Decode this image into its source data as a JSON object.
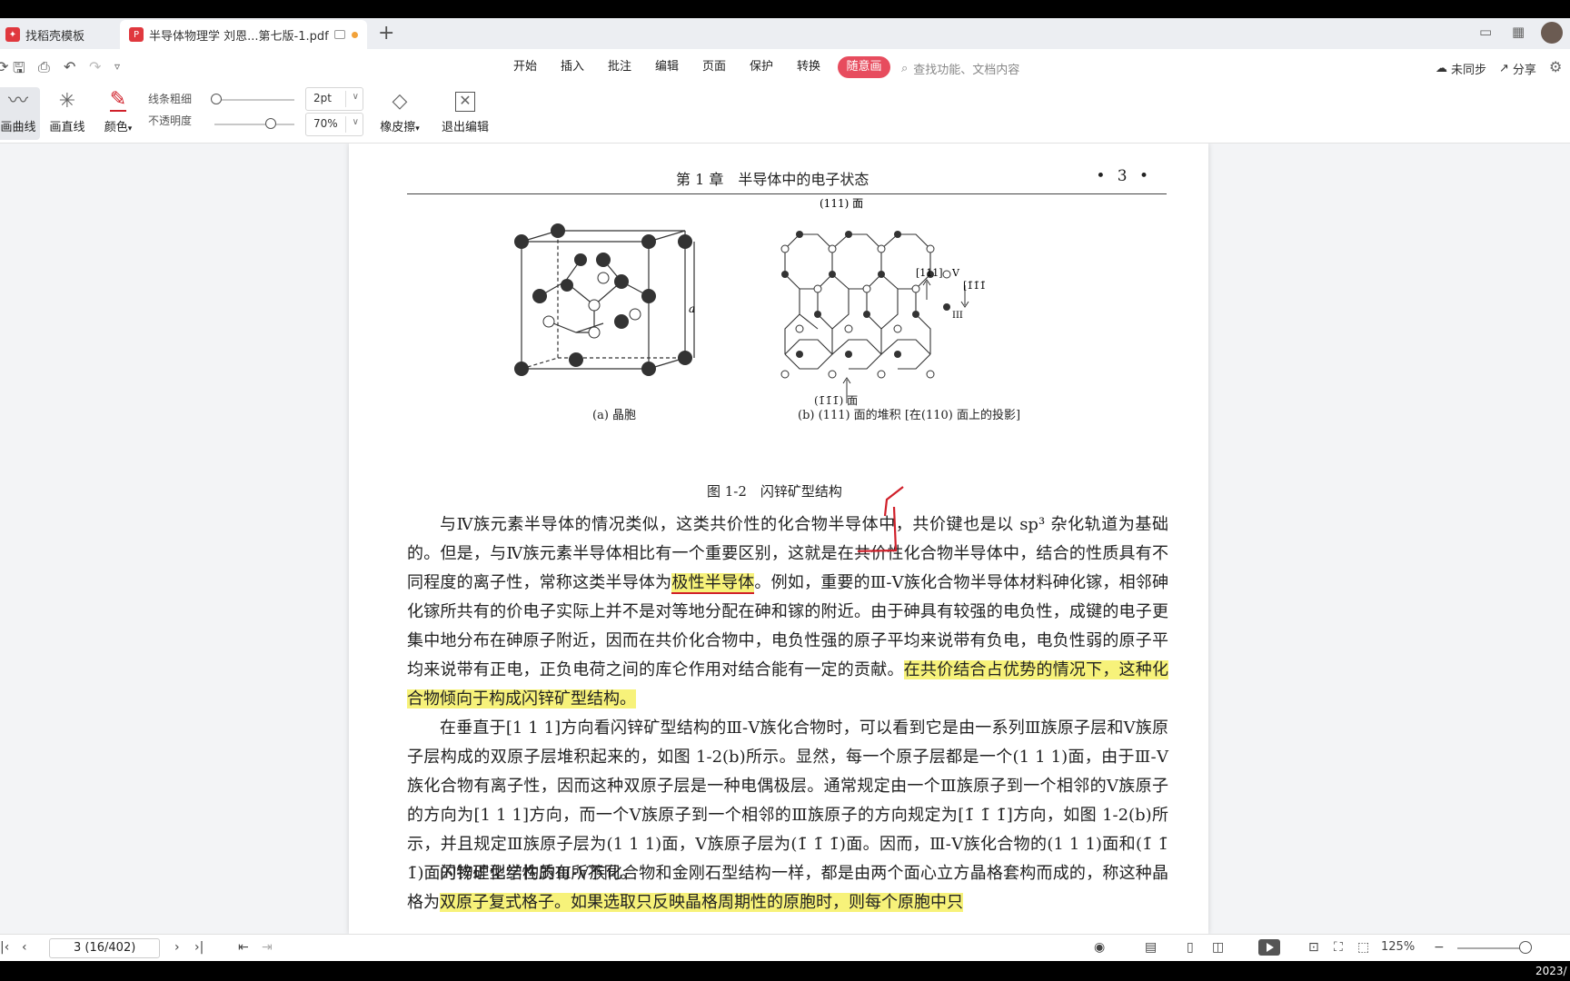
{
  "tabs": [
    {
      "label": "找稻壳模板"
    },
    {
      "label": "半导体物理学 刘恩...第七版-1.pdf"
    }
  ],
  "menu": [
    "开始",
    "插入",
    "批注",
    "编辑",
    "页面",
    "保护",
    "转换",
    "随意画"
  ],
  "search": {
    "placeholder": "查找功能、文档内容"
  },
  "sync": {
    "status": "未同步",
    "share": "分享"
  },
  "toolbar": {
    "draw_curve": "画曲线",
    "draw_line": "画直线",
    "color": "颜色",
    "line_width_label": "线条粗细",
    "line_width_value": "2pt",
    "opacity_label": "不透明度",
    "opacity_value": "70%",
    "opacity_fraction": 0.7,
    "eraser": "橡皮擦",
    "exit_edit": "退出编辑"
  },
  "page": {
    "header_title": "第 1 章　半导体中的电子状态",
    "header_num": "• 3 •",
    "fig_a_caption": "(a) 晶胞",
    "fig_b_caption": "(b) (111) 面的堆积 [在(110) 面上的投影]",
    "fig_b_top": "(111) 面",
    "fig_b_bottom": "(1̄1̄1̄) 面",
    "fig_b_dir1": "[111]",
    "fig_b_v": "V",
    "fig_b_dir2": "[1̄1̄1̄]",
    "fig_b_iii": "III",
    "fig_a_a": "a",
    "fig_title": "图 1-2　闪锌矿型结构",
    "p1_a": "与Ⅳ族元素半导体的情况类似，这类共价性的化合物半导体中，共价键也是以 sp³ 杂化轨道为基础的。但是，与Ⅳ族元素半导体相比有一个重要区别，这就是在共价性化合物半导体中，结合的性质具有不同程度的离子性，常称这类半导体为",
    "p1_hl": "极性半导体",
    "p1_b": "。例如，重要的Ⅲ-Ⅴ族化合物半导体材料砷化镓，相邻砷化镓所共有的价电子实际上并不是对等地分配在砷和镓的附近。由于砷具有较强的电负性，成键的电子更集中地分布在砷原子附近，因而在共价化合物中，电负性强的原子平均来说带有负电，电负性弱的原子平均来说带有正电，正负电荷之间的库仑作用对结合能有一定的贡献。",
    "p1_hl2": "在共价结合占优势的情况下，这种化合物倾向于构成闪锌矿型结构。",
    "p2": "在垂直于[1 1 1]方向看闪锌矿型结构的Ⅲ-Ⅴ族化合物时，可以看到它是由一系列Ⅲ族原子层和Ⅴ族原子层构成的双原子层堆积起来的，如图 1-2(b)所示。显然，每一个原子层都是一个(1 1 1)面，由于Ⅲ-Ⅴ族化合物有离子性，因而这种双原子层是一种电偶极层。通常规定由一个Ⅲ族原子到一个相邻的Ⅴ族原子的方向为[1 1 1]方向，而一个Ⅴ族原子到一个相邻的Ⅲ族原子的方向规定为[1̄ 1̄ 1̄]方向，如图 1-2(b)所示，并且规定Ⅲ族原子层为(1 1 1)面，Ⅴ族原子层为(1̄ 1̄ 1̄)面。因而，Ⅲ-Ⅴ族化合物的(1 1 1)面和(1̄ 1̄ 1̄)面的物理化学性质有所不同。",
    "p3_a": "闪锌矿型结构的Ⅲ-Ⅴ族化合物和金刚石型结构一样，都是由两个面心立方晶格套构而成的，称这种晶格为",
    "p3_hl": "双原子复式格子。如果选取只反映晶格周期性的原胞时，则每个原胞中只"
  },
  "status": {
    "page_input": "3 (16/402)",
    "zoom": "125%",
    "clock": "2023/"
  },
  "colors": {
    "accent": "#e74c5e",
    "highlight": "#f7f27a",
    "ink": "#d0202a"
  }
}
